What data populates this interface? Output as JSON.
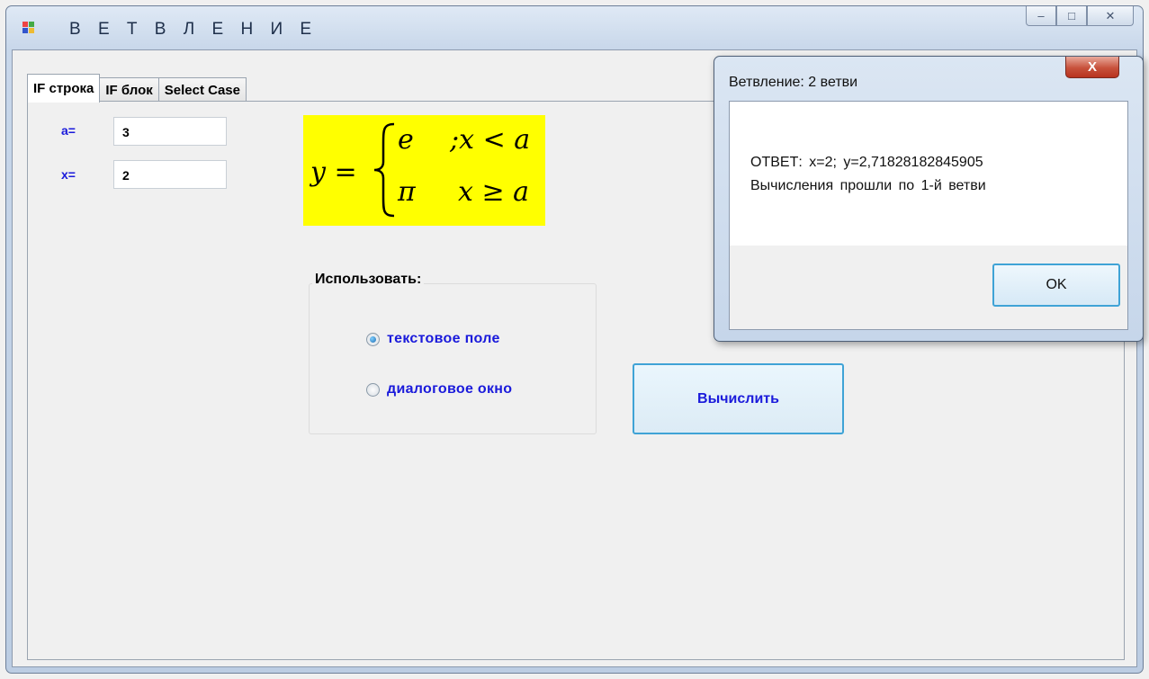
{
  "window": {
    "title": "В Е Т В Л Е Н И Е",
    "caption_minimize": "–",
    "caption_maximize": "□",
    "caption_close": "✕"
  },
  "tabs": [
    {
      "label": "IF строка"
    },
    {
      "label": "IF блок"
    },
    {
      "label": "Select Case"
    }
  ],
  "inputs": {
    "a_label": "a=",
    "a_value": "3",
    "x_label": "x=",
    "x_value": "2"
  },
  "formula": {
    "lhs": "y =",
    "case1_value": "e",
    "case1_cond": ";x < a",
    "case2_value": "π",
    "case2_cond": "x ≥ a"
  },
  "group": {
    "title": "Использовать:",
    "options": [
      {
        "label": "текстовое поле",
        "checked": true
      },
      {
        "label": "диалоговое окно",
        "checked": false
      }
    ]
  },
  "calc_button": "Вычислить",
  "message_box": {
    "title": "Ветвление: 2 ветви",
    "close_glyph": "X",
    "line1": "ОТВЕТ: x=2; y=2,71828182845905",
    "line2": "Вычисления прошли по 1-й ветви",
    "ok_label": "OK"
  }
}
